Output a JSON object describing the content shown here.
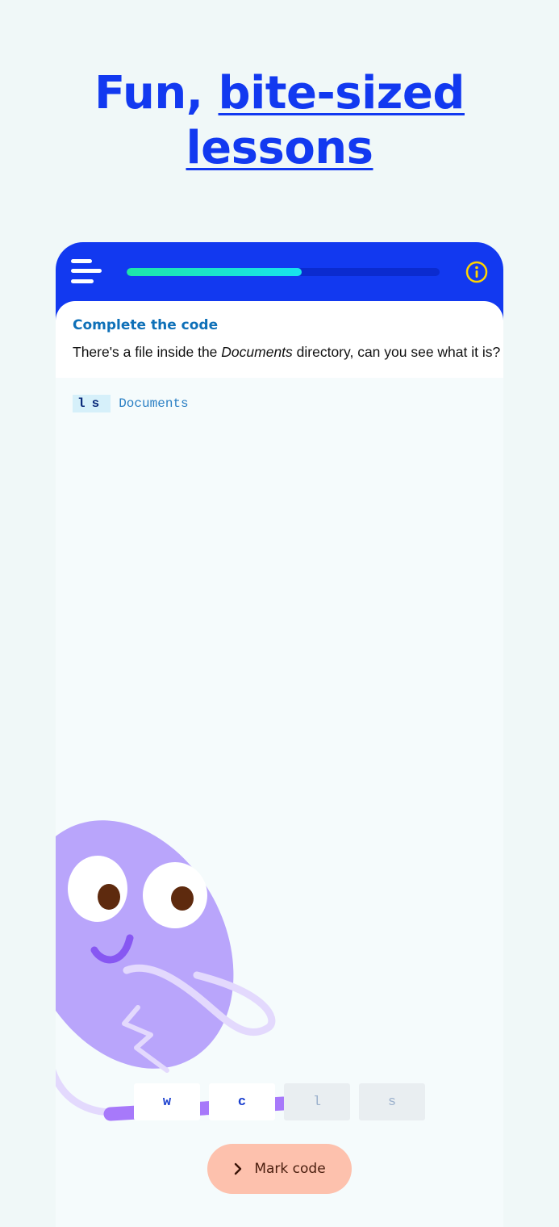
{
  "headline": {
    "plain": "Fun, ",
    "accent_line1": "bite-sized",
    "accent_line2": "lessons"
  },
  "topbar": {
    "menu_icon": "hamburger-menu-icon",
    "info_icon": "info-circle-icon",
    "progress_fraction": 0.56,
    "colors": {
      "bar": "#1239f0",
      "progress": "#1ee6a8",
      "info": "#ffd400"
    }
  },
  "exercise": {
    "title": "Complete the code",
    "prompt_before": "There's a file inside the ",
    "prompt_emphasis": "Documents",
    "prompt_after": " directory, can you see what it is?"
  },
  "code": {
    "command": "ls",
    "argument": "Documents"
  },
  "keyboard": {
    "keys": [
      {
        "label": "w",
        "used": false
      },
      {
        "label": "c",
        "used": false
      },
      {
        "label": "l",
        "used": true
      },
      {
        "label": "s",
        "used": true
      }
    ]
  },
  "actions": {
    "mark_label": "Mark code",
    "mark_icon": "chevron-right-icon",
    "mark_color": "#fdc1ad"
  }
}
